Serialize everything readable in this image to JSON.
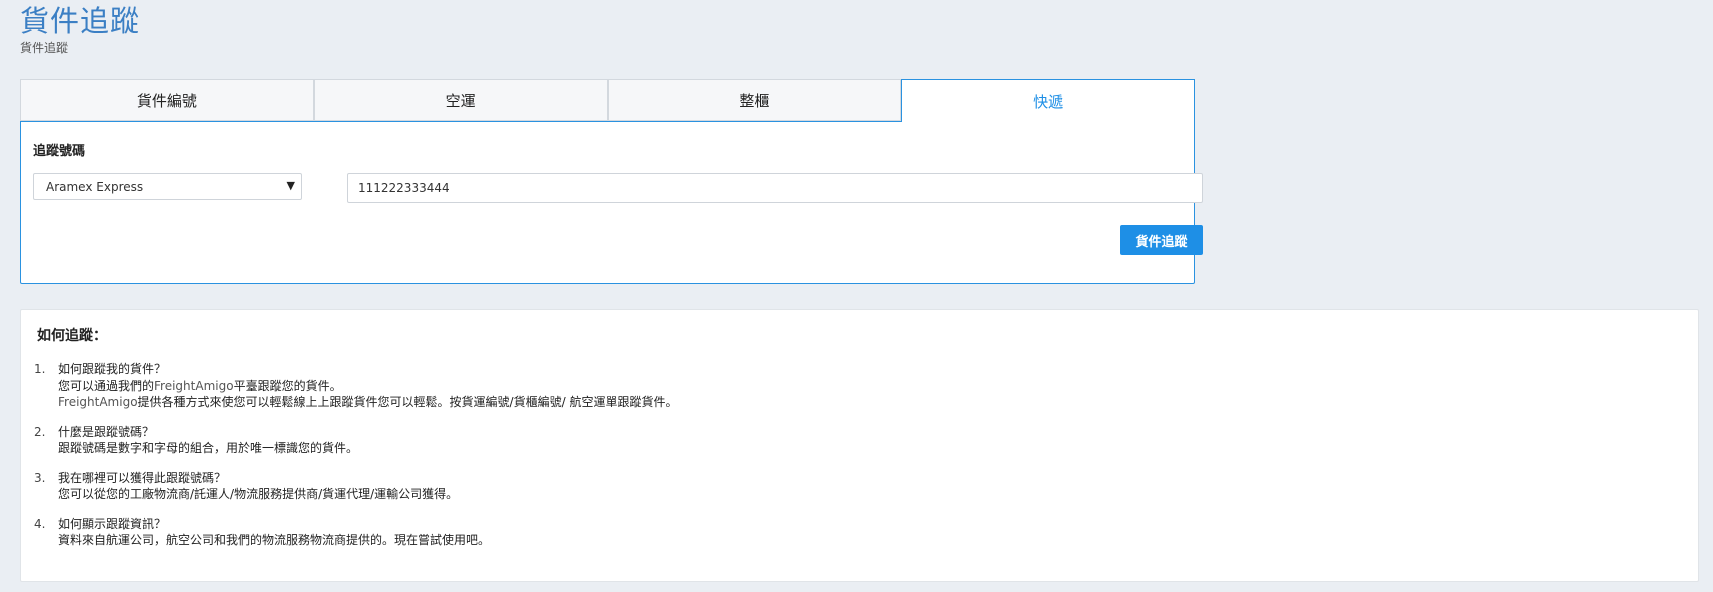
{
  "header": {
    "title": "貨件追蹤",
    "subtitle": "貨件追蹤"
  },
  "tabs": [
    {
      "label": "貨件編號",
      "active": false
    },
    {
      "label": "空運",
      "active": false
    },
    {
      "label": "整櫃",
      "active": false
    },
    {
      "label": "快遞",
      "active": true
    }
  ],
  "form": {
    "label": "追蹤號碼",
    "carrier_selected": "Aramex Express",
    "tracking_value": "111222333444",
    "submit_label": "貨件追蹤"
  },
  "faq": {
    "title": "如何追蹤：",
    "items": [
      {
        "num": "1.",
        "question": "如何跟蹤我的貨件？",
        "answer_1_pre": "您可以通過我們的",
        "answer_1_brand": "FreightAmigo",
        "answer_1_post": "平臺跟蹤您的貨件。",
        "answer_2_brand": "FreightAmigo",
        "answer_2_post": "提供各種方式來使您可以輕鬆線上上跟蹤貨件您可以輕鬆。按貨運編號/貨櫃編號/ 航空運單跟蹤貨件。"
      },
      {
        "num": "2.",
        "question": "什麼是跟蹤號碼？",
        "answer": "跟蹤號碼是數字和字母的組合，用於唯一標識您的貨件。"
      },
      {
        "num": "3.",
        "question": "我在哪裡可以獲得此跟蹤號碼？",
        "answer": "您可以從您的工廠物流商/託運人/物流服務提供商/貨運代理/運輸公司獲得。"
      },
      {
        "num": "4.",
        "question": "如何顯示跟蹤資訊？",
        "answer": "資料來自航運公司，航空公司和我們的物流服務物流商提供的。現在嘗試使用吧。"
      }
    ]
  },
  "colors": {
    "accent": "#1e8fe6",
    "title": "#3b7fc4",
    "background": "#eaeef3"
  },
  "icons": {
    "select_arrow": "caret-down-icon"
  }
}
